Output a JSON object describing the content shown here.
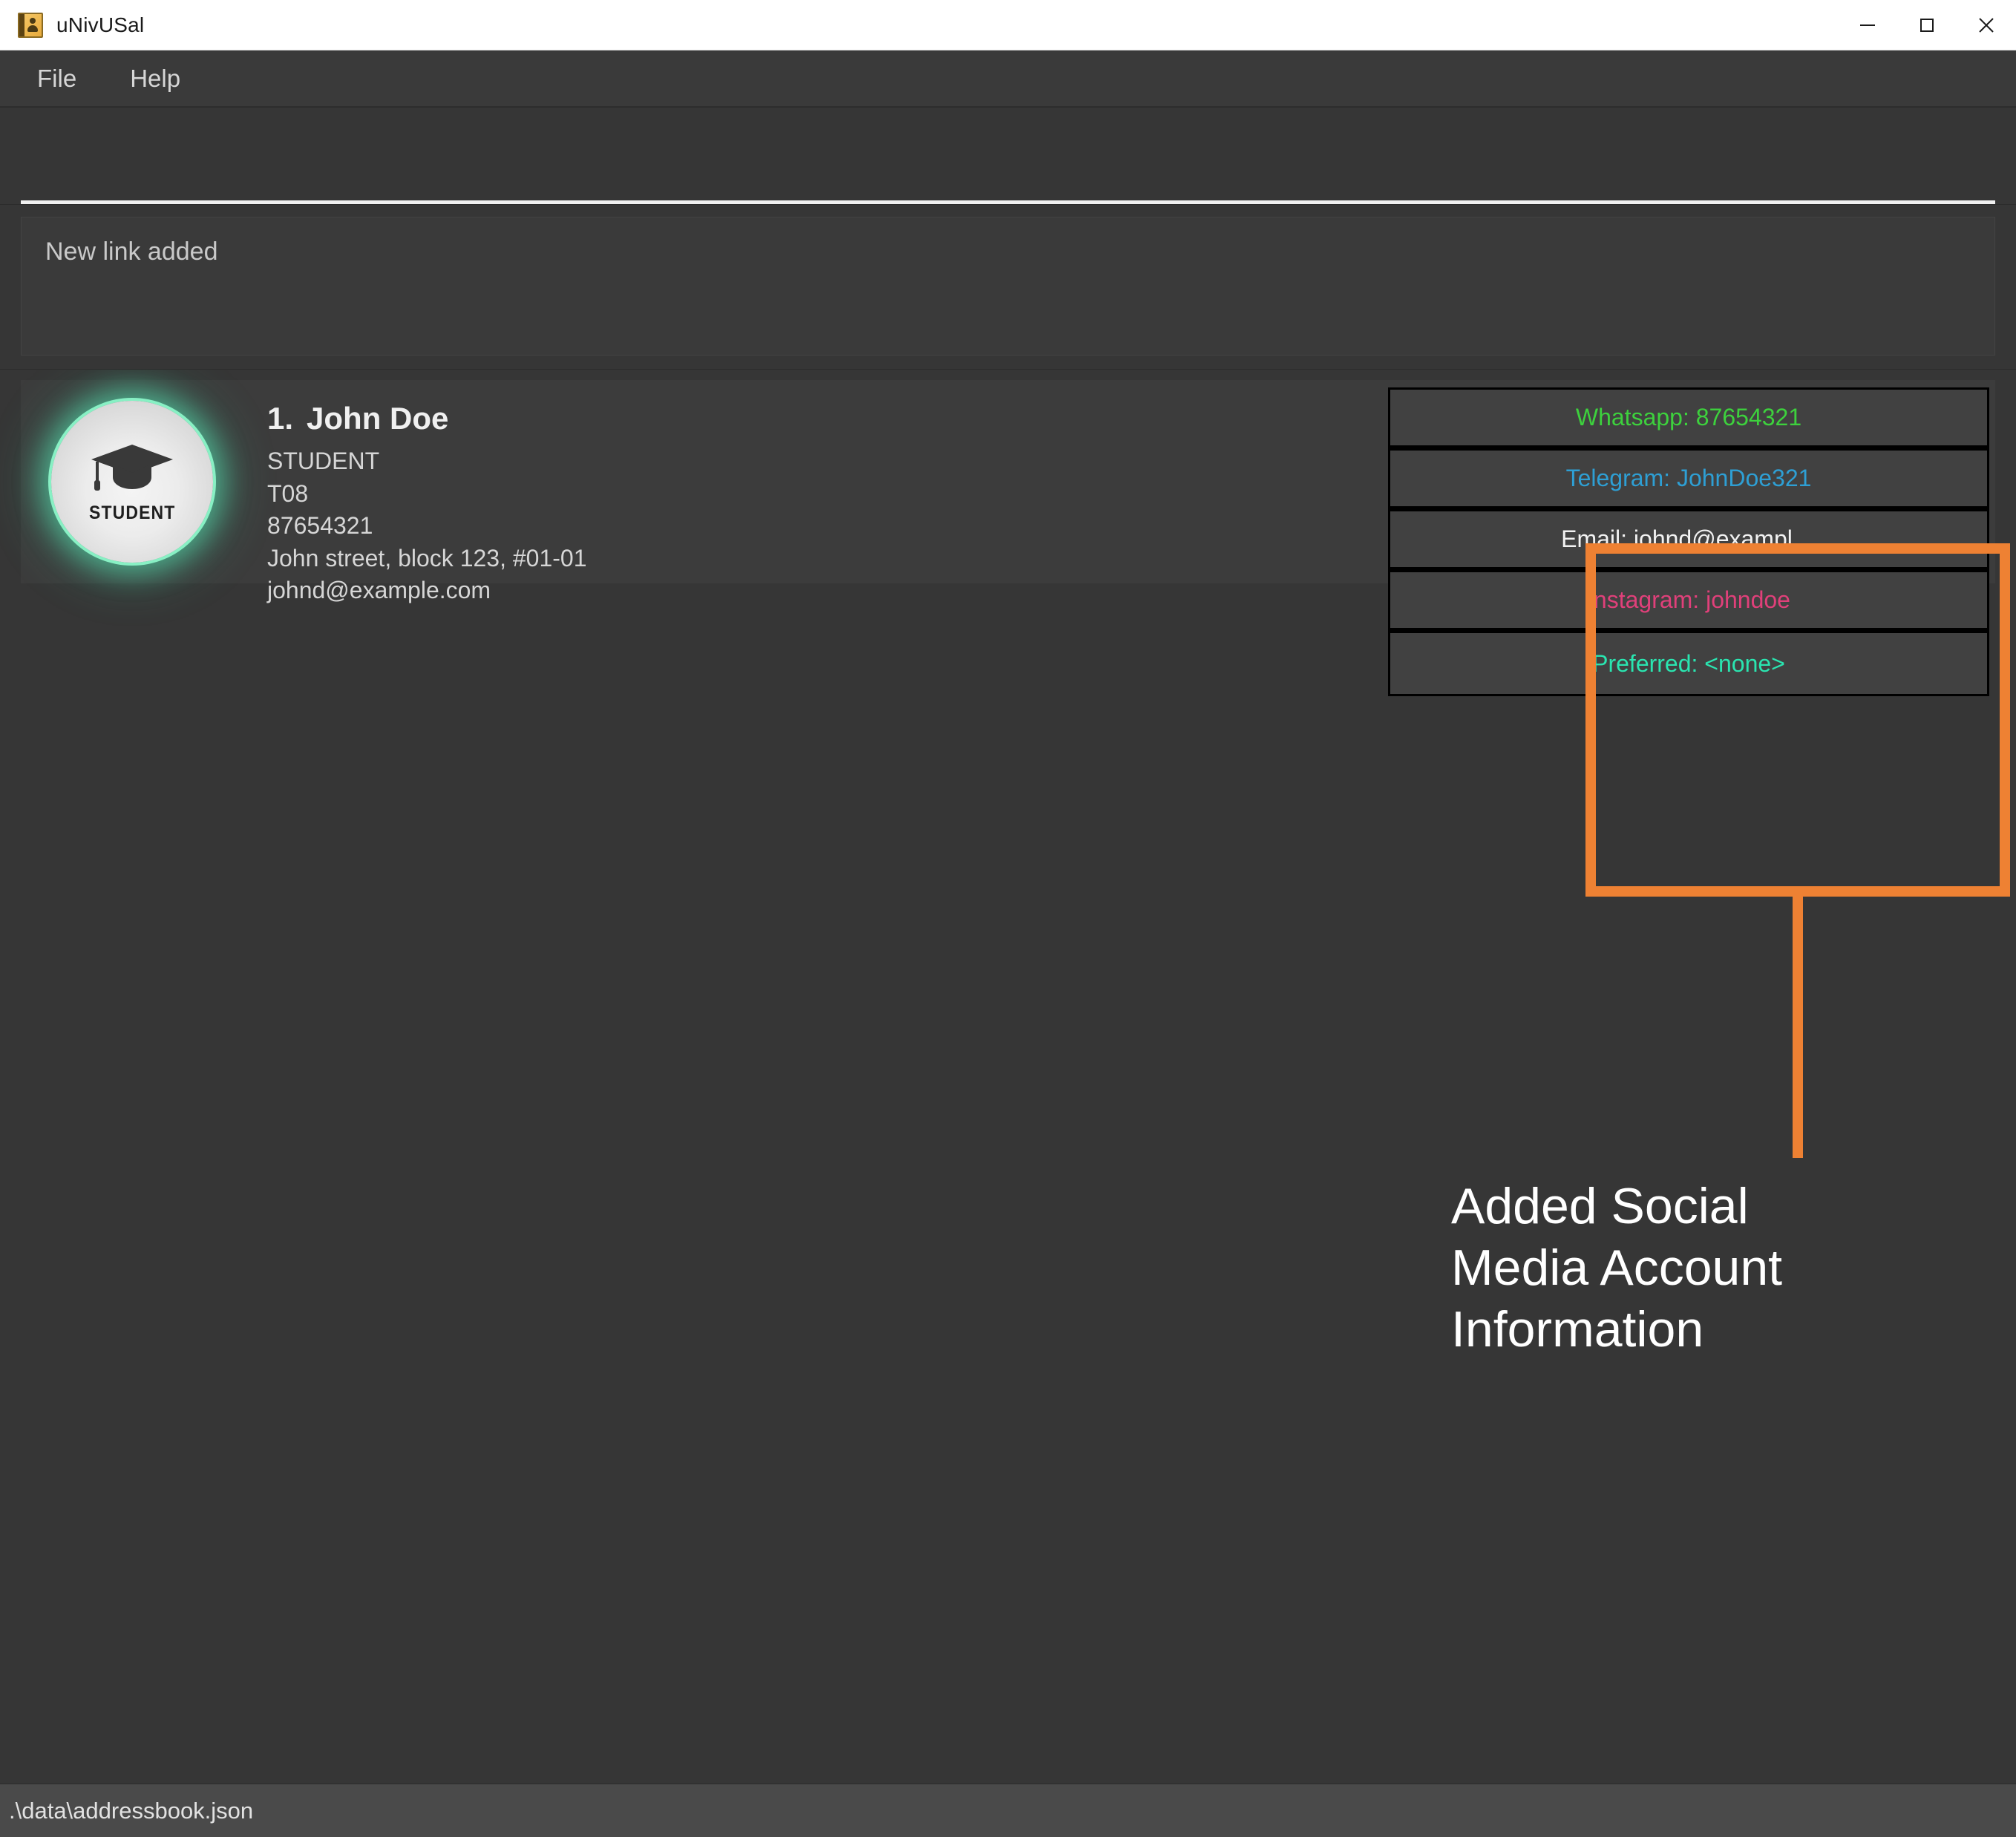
{
  "window": {
    "title": "uNivUSal",
    "icon": "address-book-icon",
    "controls": {
      "minimize": "—",
      "maximize": "□",
      "close": "×"
    }
  },
  "menu": {
    "items": [
      {
        "label": "File"
      },
      {
        "label": "Help"
      }
    ]
  },
  "command": {
    "value": "",
    "placeholder": ""
  },
  "result": {
    "message": "New link added"
  },
  "contacts": [
    {
      "index": "1.",
      "name": "John Doe",
      "avatar": {
        "role_label": "STUDENT",
        "icon": "graduation-cap-icon",
        "glow_color": "#88f0c4"
      },
      "lines": [
        "STUDENT",
        "T08",
        "87654321",
        "John street, block 123, #01-01",
        "johnd@example.com"
      ],
      "badges": [
        {
          "name": "whatsapp",
          "text": "Whatsapp: 87654321",
          "color": "#3dd13d"
        },
        {
          "name": "telegram",
          "text": "Telegram: JohnDoe321",
          "color": "#2e9fd4"
        },
        {
          "name": "email",
          "text": "Email: johnd@exampl…",
          "color": "#f2f2f2"
        },
        {
          "name": "instagram",
          "text": "Instagram: johndoe",
          "color": "#e0407a"
        },
        {
          "name": "preferred",
          "text": "Preferred: <none>",
          "color": "#2ae5b0"
        }
      ]
    }
  ],
  "annotation": {
    "text": "Added Social Media Account Information",
    "color": "#ee8133"
  },
  "status_bar": {
    "path": ".\\data\\addressbook.json"
  }
}
